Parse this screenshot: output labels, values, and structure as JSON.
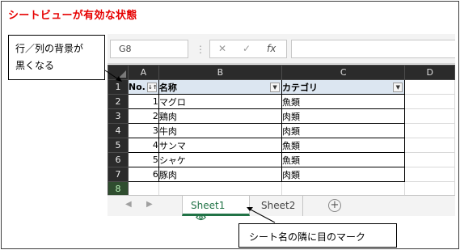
{
  "page_title": "シートビューが有効な状態",
  "callouts": {
    "left_line1": "行／列の背景が",
    "left_line2": "黒くなる",
    "bottom": "シート名の隣に目のマーク"
  },
  "formula_bar": {
    "namebox": "G8",
    "separator": "⋮",
    "cancel_icon": "✕",
    "enter_icon": "✓",
    "fx_icon": "fx",
    "formula": ""
  },
  "columns": [
    "A",
    "B",
    "C",
    "D"
  ],
  "rows": [
    "1",
    "2",
    "3",
    "4",
    "5",
    "6",
    "7",
    "8"
  ],
  "table": {
    "headers": [
      "No.",
      "名称",
      "カテゴリ"
    ],
    "data": [
      [
        "1",
        "マグロ",
        "魚類"
      ],
      [
        "2",
        "鶏肉",
        "肉類"
      ],
      [
        "3",
        "牛肉",
        "肉類"
      ],
      [
        "4",
        "サンマ",
        "魚類"
      ],
      [
        "5",
        "シャケ",
        "魚類"
      ],
      [
        "6",
        "豚肉",
        "肉類"
      ]
    ]
  },
  "filter_icons": {
    "sorted": "↓↑",
    "dropdown": "▼"
  },
  "tabs": {
    "nav_prev": "◀",
    "nav_next": "▶",
    "active": "Sheet1",
    "inactive": "Sheet2",
    "add": "+"
  },
  "colors": {
    "title_red": "#e60000",
    "excel_green": "#217346",
    "header_dark": "#2b2b2b",
    "table_header_fill": "#dce6f1"
  },
  "icons": {
    "eye": "eye-icon",
    "add_sheet": "plus-circle-icon"
  }
}
